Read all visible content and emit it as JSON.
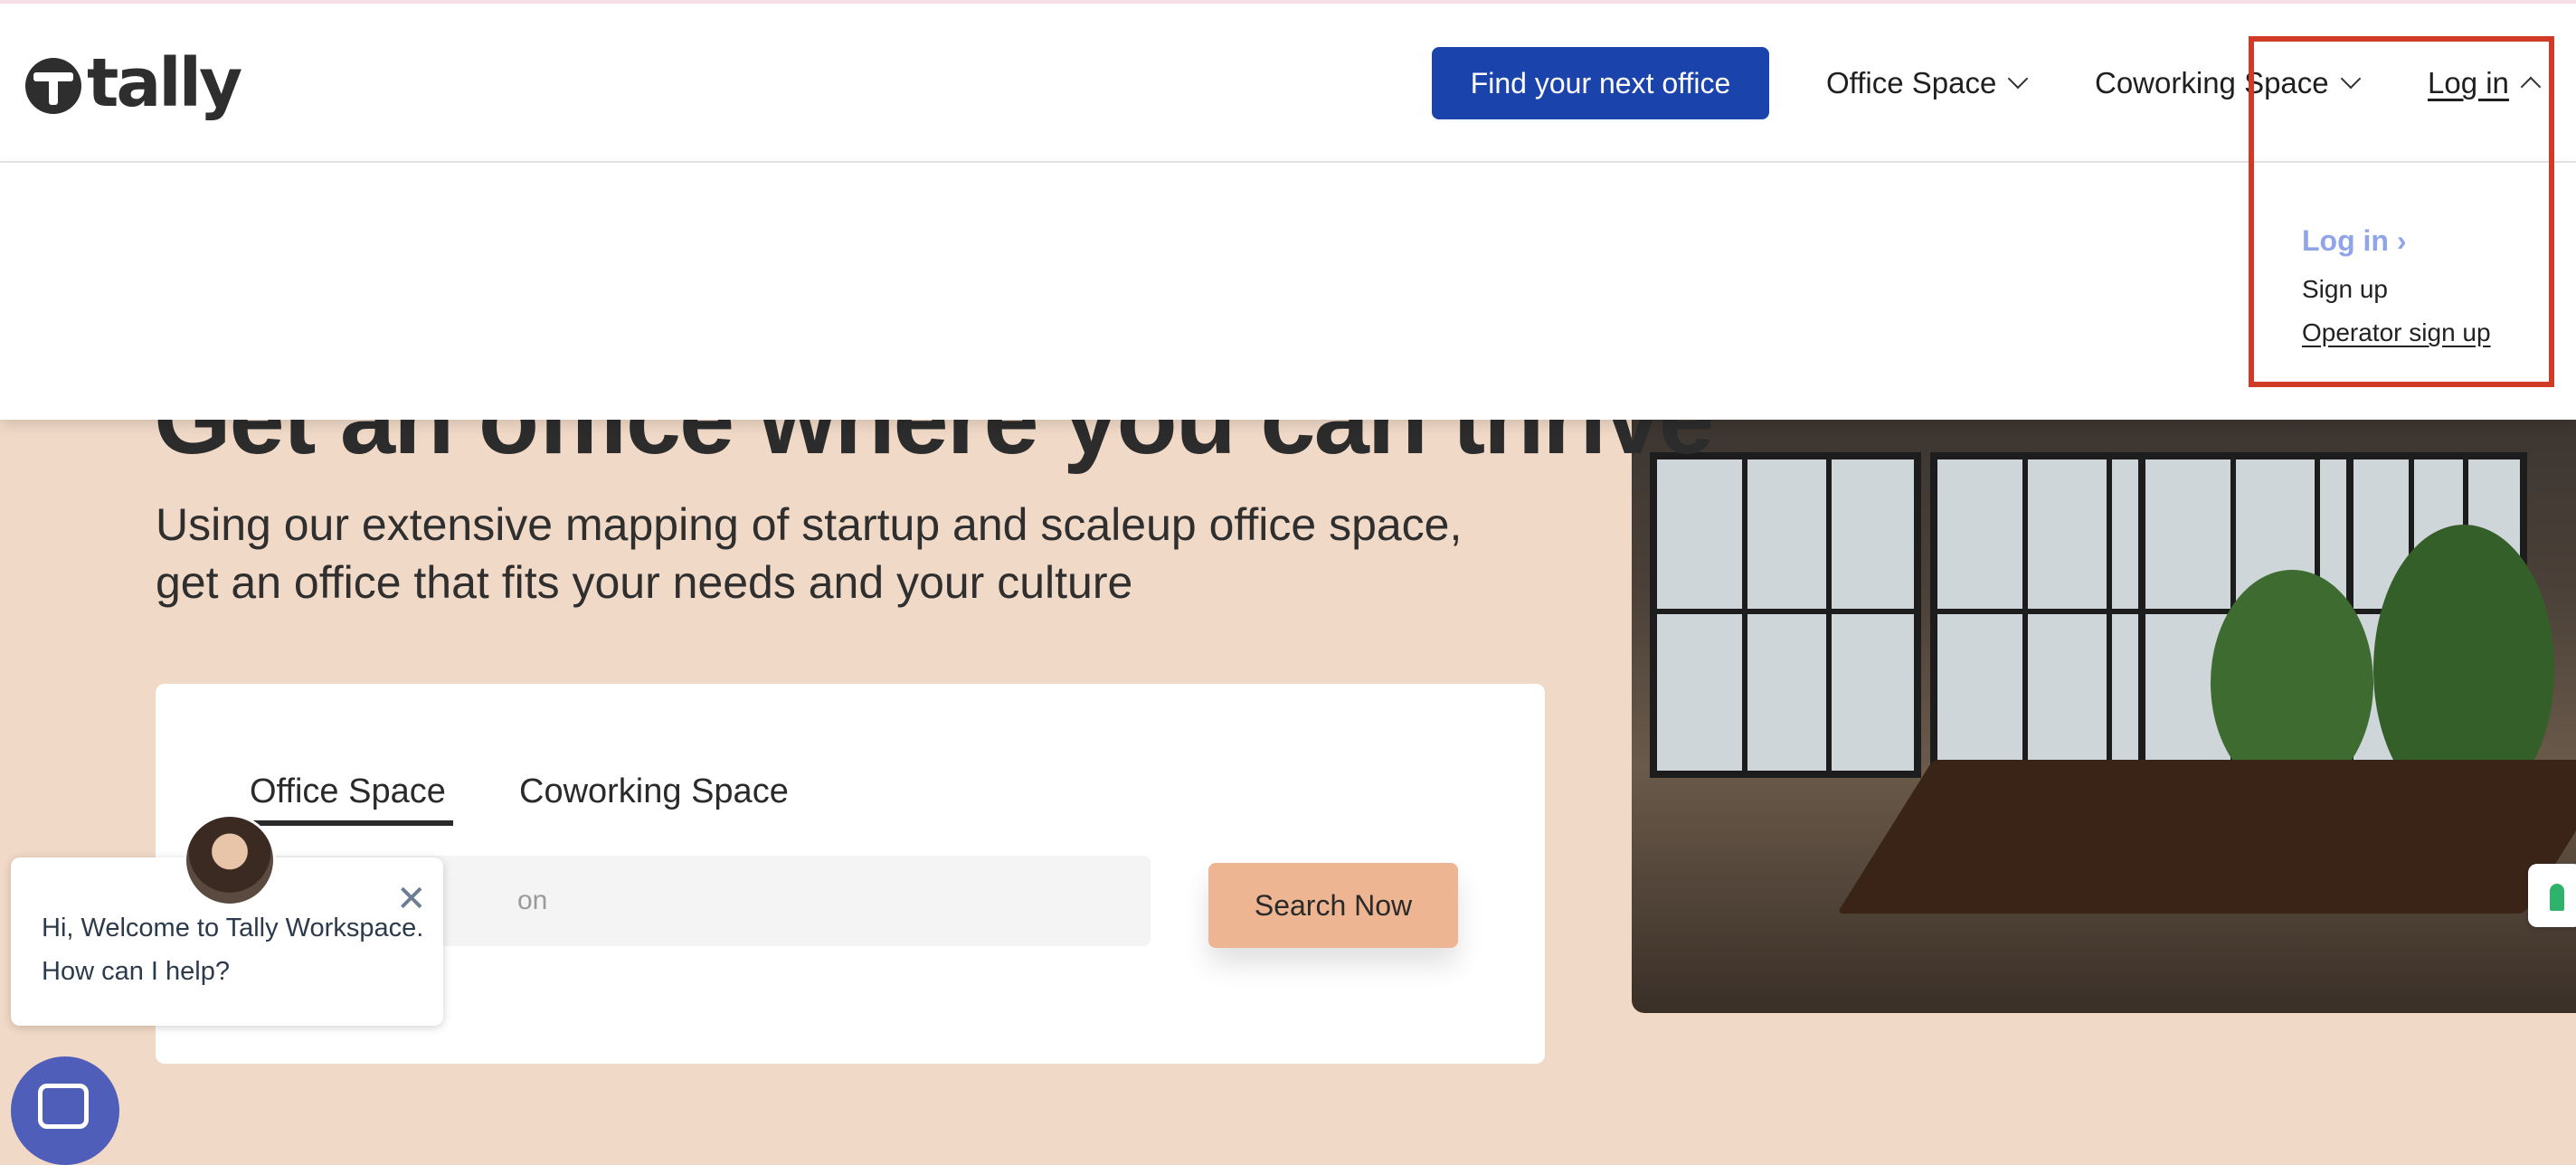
{
  "header": {
    "logo_text": "tally",
    "find_office_button": "Find your next office",
    "nav": {
      "office_space": "Office Space",
      "coworking_space": "Coworking Space",
      "log_in": "Log in"
    }
  },
  "login_dropdown": {
    "log_in": "Log in ›",
    "sign_up": "Sign up",
    "operator_sign_up": "Operator sign up"
  },
  "hero": {
    "title": "Get an office where you can thrive",
    "subtitle": "Using our extensive mapping of startup and scaleup office space, get an office that fits your needs and your culture"
  },
  "search": {
    "tabs": [
      "Office Space",
      "Coworking Space"
    ],
    "active_tab": "Office Space",
    "input_visible_text": "on",
    "button": "Search Now"
  },
  "chat": {
    "close_symbol": "✕",
    "message": "Hi, Welcome to Tally Workspace. How can I help?"
  },
  "colors": {
    "primary_button": "#1a43ab",
    "search_button": "#edb592",
    "hero_background": "#f1d9c7",
    "dropdown_login_link": "#8fa5e8",
    "highlight_box": "#d13b25"
  },
  "icons": [
    "tally-logo-icon",
    "chevron-down-icon",
    "chevron-up-icon",
    "close-icon",
    "chat-icon",
    "feedback-icon"
  ]
}
